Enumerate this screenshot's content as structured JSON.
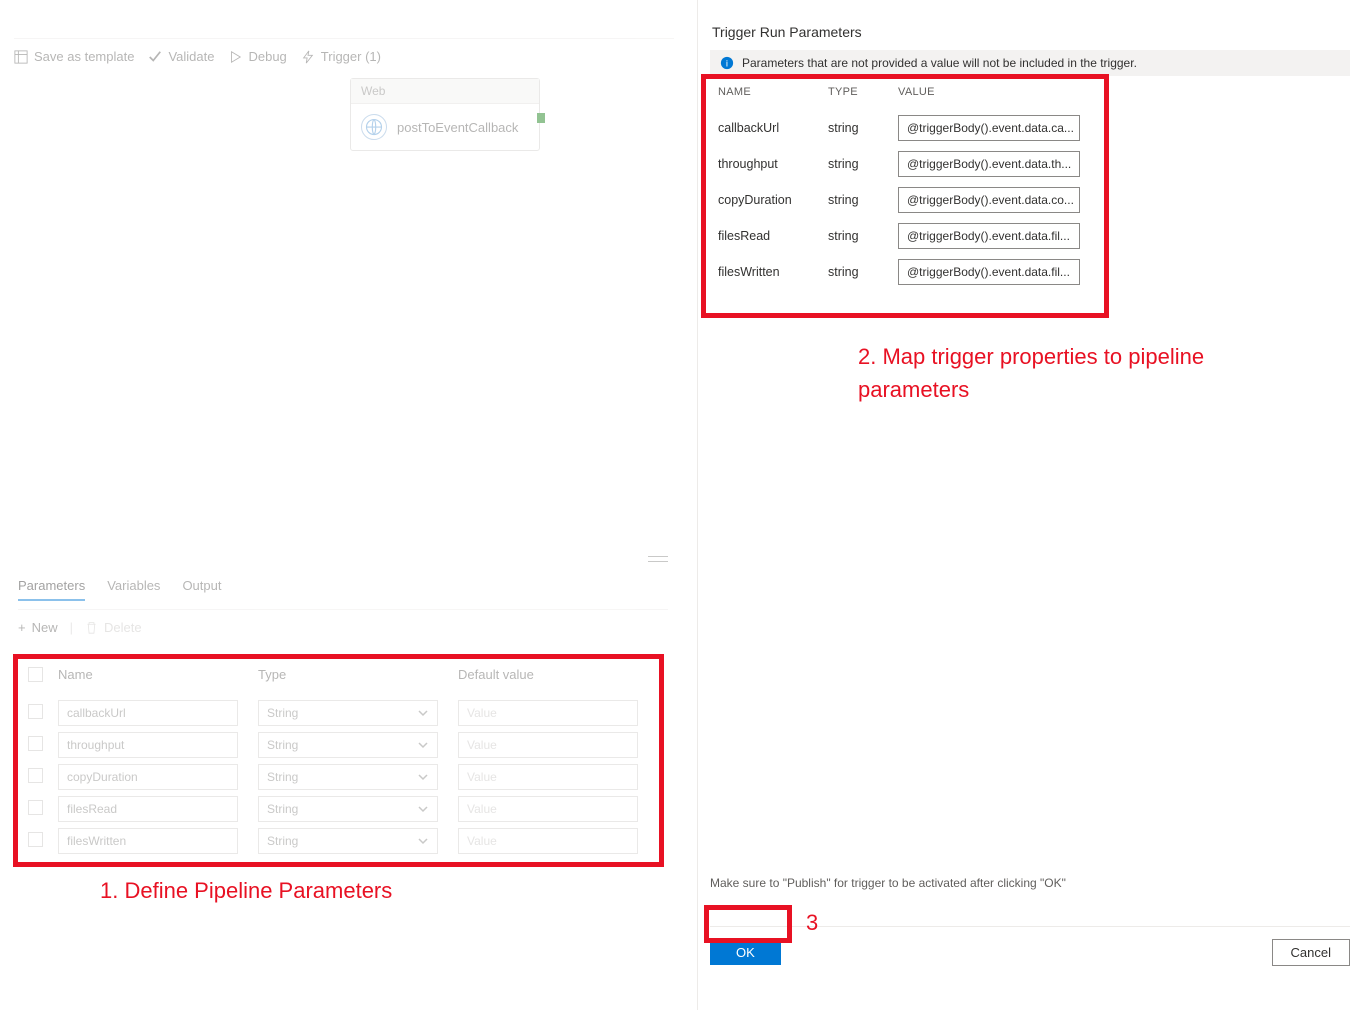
{
  "toolbar": {
    "save_template": "Save as template",
    "validate": "Validate",
    "debug": "Debug",
    "trigger": "Trigger (1)"
  },
  "activity": {
    "type": "Web",
    "name": "postToEventCallback"
  },
  "tabs": {
    "parameters": "Parameters",
    "variables": "Variables",
    "output": "Output"
  },
  "subtoolbar": {
    "new": "New",
    "delete": "Delete"
  },
  "params_header": {
    "name": "Name",
    "type": "Type",
    "default": "Default value"
  },
  "params": [
    {
      "name": "callbackUrl",
      "type": "String",
      "default": "Value"
    },
    {
      "name": "throughput",
      "type": "String",
      "default": "Value"
    },
    {
      "name": "copyDuration",
      "type": "String",
      "default": "Value"
    },
    {
      "name": "filesRead",
      "type": "String",
      "default": "Value"
    },
    {
      "name": "filesWritten",
      "type": "String",
      "default": "Value"
    }
  ],
  "panel": {
    "title": "Trigger Run Parameters",
    "info": "Parameters that are not provided a value will not be included in the trigger."
  },
  "trg_header": {
    "name": "NAME",
    "type": "TYPE",
    "value": "VALUE"
  },
  "trg_rows": [
    {
      "name": "callbackUrl",
      "type": "string",
      "value": "@triggerBody().event.data.ca..."
    },
    {
      "name": "throughput",
      "type": "string",
      "value": "@triggerBody().event.data.th..."
    },
    {
      "name": "copyDuration",
      "type": "string",
      "value": "@triggerBody().event.data.co..."
    },
    {
      "name": "filesRead",
      "type": "string",
      "value": "@triggerBody().event.data.fil..."
    },
    {
      "name": "filesWritten",
      "type": "string",
      "value": "@triggerBody().event.data.fil..."
    }
  ],
  "hint": "Make sure to \"Publish\" for trigger to be activated after clicking \"OK\"",
  "buttons": {
    "ok": "OK",
    "cancel": "Cancel"
  },
  "annotations": {
    "step1": "1. Define Pipeline Parameters",
    "step2": "2. Map trigger properties to pipeline parameters",
    "step3": "3"
  }
}
